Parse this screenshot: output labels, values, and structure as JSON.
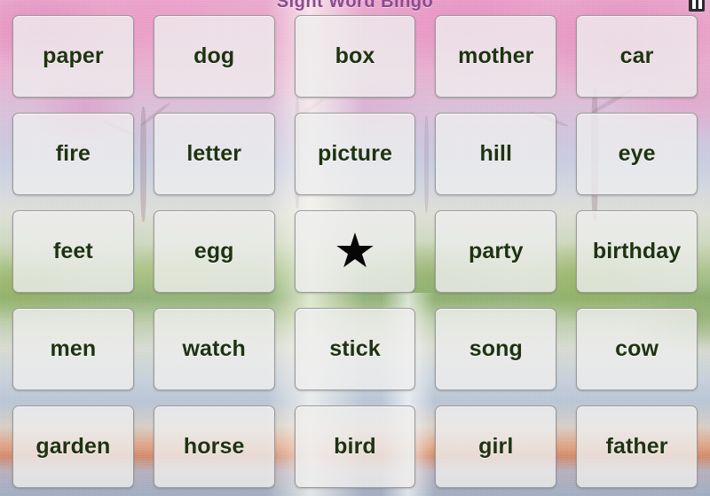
{
  "header": {
    "title": "Sight Word Bingo",
    "title_color": "#8a4a8f",
    "pause_label": "Pause"
  },
  "theme": {
    "tile_face": "#eeeeee",
    "tile_border": "#9a9a9a",
    "word_color": "#1e3311",
    "star_color": "#060606",
    "background_description": "watercolor cherry blossom landscape"
  },
  "board": {
    "columns": 5,
    "rows": 5,
    "free_space": {
      "row": 3,
      "column": 3,
      "symbol": "★",
      "name": "free-space-star"
    },
    "cells": [
      {
        "word": "paper",
        "free": false
      },
      {
        "word": "dog",
        "free": false
      },
      {
        "word": "box",
        "free": false
      },
      {
        "word": "mother",
        "free": false
      },
      {
        "word": "car",
        "free": false
      },
      {
        "word": "fire",
        "free": false
      },
      {
        "word": "letter",
        "free": false
      },
      {
        "word": "picture",
        "free": false
      },
      {
        "word": "hill",
        "free": false
      },
      {
        "word": "eye",
        "free": false
      },
      {
        "word": "feet",
        "free": false
      },
      {
        "word": "egg",
        "free": false
      },
      {
        "word": "★",
        "free": true
      },
      {
        "word": "party",
        "free": false
      },
      {
        "word": "birthday",
        "free": false
      },
      {
        "word": "men",
        "free": false
      },
      {
        "word": "watch",
        "free": false
      },
      {
        "word": "stick",
        "free": false
      },
      {
        "word": "song",
        "free": false
      },
      {
        "word": "cow",
        "free": false
      },
      {
        "word": "garden",
        "free": false
      },
      {
        "word": "horse",
        "free": false
      },
      {
        "word": "bird",
        "free": false
      },
      {
        "word": "girl",
        "free": false
      },
      {
        "word": "father",
        "free": false
      }
    ]
  }
}
